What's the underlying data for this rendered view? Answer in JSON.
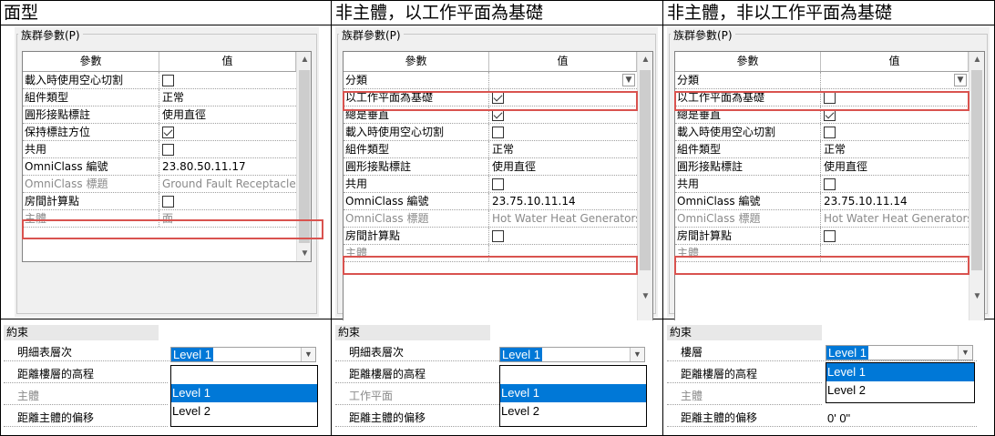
{
  "columns": [
    {
      "title": "面型",
      "group_label": "族群參數(P)",
      "header": {
        "param": "參數",
        "value": "值"
      },
      "rows": [
        {
          "key": "載入時使用空心切割",
          "type": "checkbox",
          "checked": false
        },
        {
          "key": "組件類型",
          "value": "正常"
        },
        {
          "key": "圓形接點標註",
          "value": "使用直徑"
        },
        {
          "key": "保持標註方位",
          "type": "checkbox",
          "checked": true
        },
        {
          "key": "共用",
          "type": "checkbox",
          "checked": false
        },
        {
          "key": "OmniClass 編號",
          "value": "23.80.50.11.17"
        },
        {
          "key": "OmniClass 標題",
          "value": "Ground Fault Receptacles",
          "gray": true
        },
        {
          "key": "房間計算點",
          "type": "checkbox",
          "checked": false
        },
        {
          "key": "主體",
          "value": "面",
          "gray": true
        }
      ],
      "constraints": {
        "head": "約束",
        "rows": [
          {
            "key": "明細表層次",
            "value": "Level 1"
          },
          {
            "key": "距離樓層的高程"
          },
          {
            "key": "主體",
            "gray": true
          },
          {
            "key": "距離主體的偏移"
          }
        ],
        "options": [
          "Level 1",
          "Level 2"
        ]
      }
    },
    {
      "title": "非主體，以工作平面為基礎",
      "group_label": "族群參數(P)",
      "header": {
        "param": "參數",
        "value": "值"
      },
      "rows": [
        {
          "key": "分類",
          "type": "select"
        },
        {
          "key": "以工作平面為基礎",
          "type": "checkbox",
          "checked": true
        },
        {
          "key": "總是垂直",
          "type": "checkbox",
          "checked": true
        },
        {
          "key": "載入時使用空心切割",
          "type": "checkbox",
          "checked": false
        },
        {
          "key": "組件類型",
          "value": "正常"
        },
        {
          "key": "圓形接點標註",
          "value": "使用直徑"
        },
        {
          "key": "共用",
          "type": "checkbox",
          "checked": false
        },
        {
          "key": "OmniClass 編號",
          "value": "23.75.10.11.14"
        },
        {
          "key": "OmniClass 標題",
          "value": "Hot Water Heat Generators",
          "gray": true
        },
        {
          "key": "房間計算點",
          "type": "checkbox",
          "checked": false
        },
        {
          "key": "主體",
          "value": "",
          "gray": true
        }
      ],
      "constraints": {
        "head": "約束",
        "rows": [
          {
            "key": "明細表層次",
            "value": "Level 1"
          },
          {
            "key": "距離樓層的高程"
          },
          {
            "key": "工作平面",
            "gray": true
          },
          {
            "key": "距離主體的偏移"
          }
        ],
        "options": [
          "Level 1",
          "Level 2"
        ]
      }
    },
    {
      "title": "非主體，非以工作平面為基礎",
      "group_label": "族群參數(P)",
      "header": {
        "param": "參數",
        "value": "值"
      },
      "rows": [
        {
          "key": "分類",
          "type": "select"
        },
        {
          "key": "以工作平面為基礎",
          "type": "checkbox",
          "checked": false
        },
        {
          "key": "總是垂直",
          "type": "checkbox",
          "checked": true
        },
        {
          "key": "載入時使用空心切割",
          "type": "checkbox",
          "checked": false
        },
        {
          "key": "組件類型",
          "value": "正常"
        },
        {
          "key": "圓形接點標註",
          "value": "使用直徑"
        },
        {
          "key": "共用",
          "type": "checkbox",
          "checked": false
        },
        {
          "key": "OmniClass 編號",
          "value": "23.75.10.11.14"
        },
        {
          "key": "OmniClass 標題",
          "value": "Hot Water Heat Generators",
          "gray": true
        },
        {
          "key": "房間計算點",
          "type": "checkbox",
          "checked": false
        },
        {
          "key": "主體",
          "value": "",
          "gray": true
        }
      ],
      "constraints": {
        "head": "約束",
        "rows": [
          {
            "key": "樓層",
            "value": "Level 1"
          },
          {
            "key": "距離樓層的高程"
          },
          {
            "key": "主體",
            "gray": true
          },
          {
            "key": "距離主體的偏移",
            "value": "0'  0\""
          }
        ],
        "options": [
          "Level 1",
          "Level 2"
        ]
      }
    }
  ]
}
